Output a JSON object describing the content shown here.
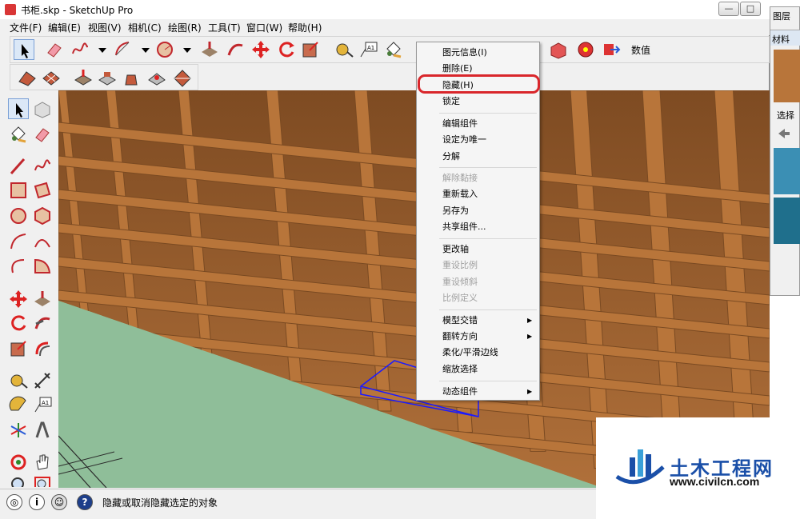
{
  "window": {
    "title": "书柜.skp - SketchUp Pro",
    "minimize_glyph": "—",
    "maximize_glyph": "□"
  },
  "menubar": {
    "items": [
      "文件(F)",
      "编辑(E)",
      "视图(V)",
      "相机(C)",
      "绘图(R)",
      "工具(T)",
      "窗口(W)",
      "帮助(H)"
    ]
  },
  "toolbar": {
    "value_label": "数值"
  },
  "context_menu": {
    "items": [
      {
        "label": "图元信息(I)",
        "enabled": true
      },
      {
        "label": "删除(E)",
        "enabled": true
      },
      {
        "label": "隐藏(H)",
        "enabled": true,
        "highlighted": true
      },
      {
        "label": "锁定",
        "enabled": true
      },
      {
        "label": "编辑组件",
        "enabled": true
      },
      {
        "label": "设定为唯一",
        "enabled": true
      },
      {
        "label": "分解",
        "enabled": true
      },
      {
        "label": "解除黏接",
        "enabled": false
      },
      {
        "label": "重新载入",
        "enabled": true
      },
      {
        "label": "另存为",
        "enabled": true
      },
      {
        "label": "共享组件...",
        "enabled": true
      },
      {
        "label": "更改轴",
        "enabled": true
      },
      {
        "label": "重设比例",
        "enabled": false
      },
      {
        "label": "重设倾斜",
        "enabled": false
      },
      {
        "label": "比例定义",
        "enabled": false
      },
      {
        "label": "模型交错",
        "enabled": true,
        "submenu": true
      },
      {
        "label": "翻转方向",
        "enabled": true,
        "submenu": true
      },
      {
        "label": "柔化/平滑边线",
        "enabled": true
      },
      {
        "label": "缩放选择",
        "enabled": true
      },
      {
        "label": "动态组件",
        "enabled": true,
        "submenu": true
      }
    ],
    "submenu_glyph": "▶",
    "highlight_color": "#d9262b"
  },
  "statusbar": {
    "text": "隐藏或取消隐藏选定的对象",
    "help_glyph": "?",
    "info_glyph": "i"
  },
  "right_panel": {
    "layers_tab": "图层",
    "materials_tab": "材料",
    "select_label": "选择"
  },
  "watermark": {
    "title": "土木工程网",
    "url": "www.civilcn.com"
  },
  "colors": {
    "wood": "#b8753a",
    "wood_dark": "#7a4a22",
    "ground": "#8fbe99",
    "selection": "#1a1aff"
  }
}
